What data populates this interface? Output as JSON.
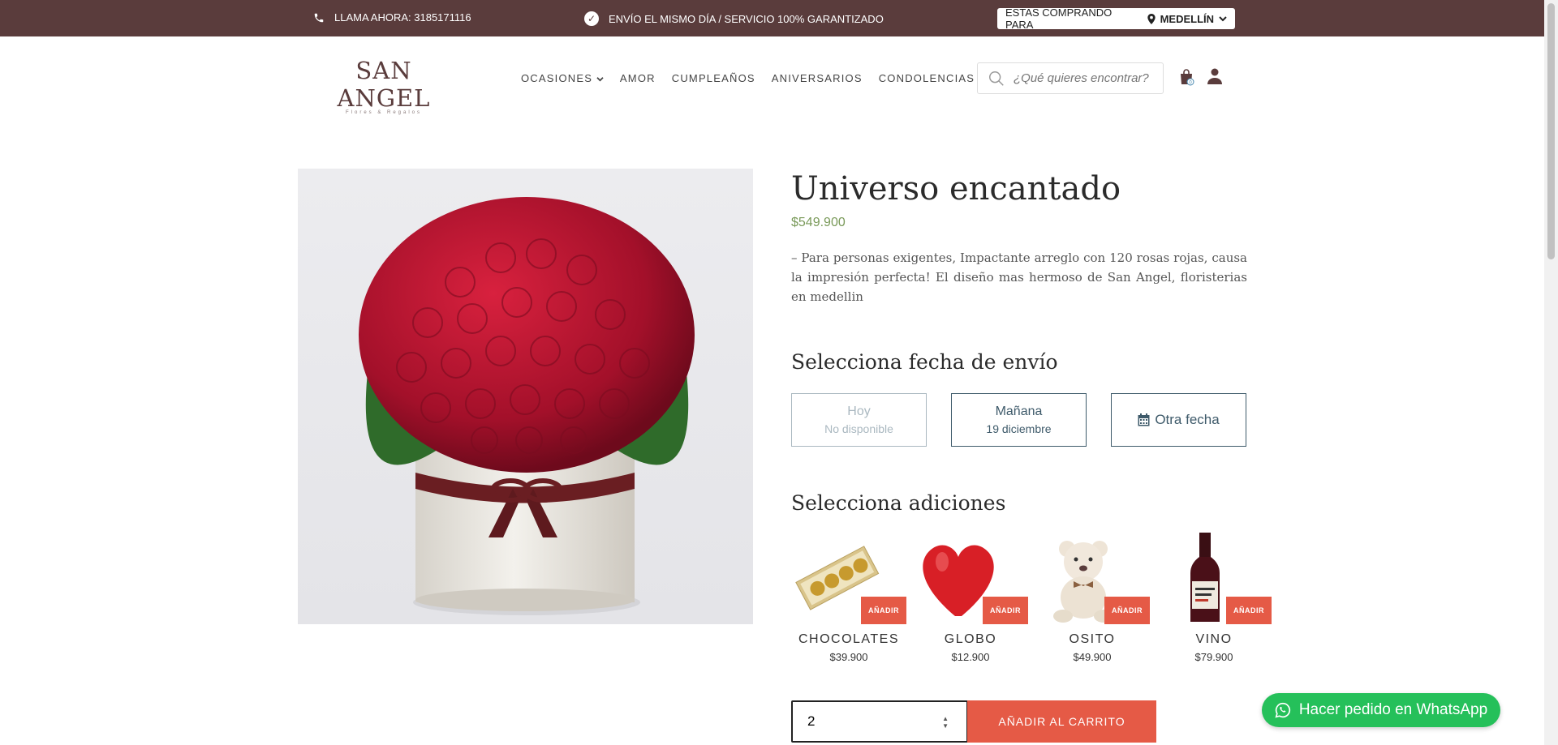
{
  "topbar": {
    "phone": "LLAMA AHORA: 3185171116",
    "shipping": "ENVÍO EL MISMO DÍA / SERVICIO 100% GARANTIZADO",
    "city_prefix": "ESTAS COMPRANDO PARA",
    "city": "MEDELLÍN"
  },
  "logo": {
    "name": "SAN ANGEL",
    "subtitle": "Flores & Regalos"
  },
  "nav": {
    "items": [
      "OCASIONES",
      "AMOR",
      "CUMPLEAÑOS",
      "ANIVERSARIOS",
      "CONDOLENCIAS"
    ]
  },
  "search": {
    "placeholder": "¿Qué quieres encontrar?"
  },
  "cart": {
    "count": "0"
  },
  "product": {
    "title": "Universo encantado",
    "price": "$549.900",
    "description": "– Para personas exigentes, Impactante arreglo con 120 rosas rojas, causa la impresión perfecta! El diseño mas hermoso de San Angel, floristerias en medellin"
  },
  "dates": {
    "heading": "Selecciona fecha de envío",
    "today": {
      "label": "Hoy",
      "sub": "No disponible"
    },
    "tomorrow": {
      "label": "Mañana",
      "sub": "19 diciembre"
    },
    "other": {
      "label": "Otra fecha"
    }
  },
  "addons": {
    "heading": "Selecciona adiciones",
    "add_label": "AÑADIR",
    "items": [
      {
        "name": "CHOCOLATES",
        "price": "$39.900"
      },
      {
        "name": "GLOBO",
        "price": "$12.900"
      },
      {
        "name": "OSITO",
        "price": "$49.900"
      },
      {
        "name": "VINO",
        "price": "$79.900"
      }
    ]
  },
  "purchase": {
    "quantity": "2",
    "add_to_cart": "AÑADIR AL CARRITO"
  },
  "whatsapp": {
    "label": "Hacer pedido en WhatsApp"
  },
  "colors": {
    "topbar": "#5a3c3c",
    "accent": "#e55a46",
    "price": "#7a9a5a",
    "whatsapp": "#25c05a",
    "date_border": "#3e5a6a"
  }
}
